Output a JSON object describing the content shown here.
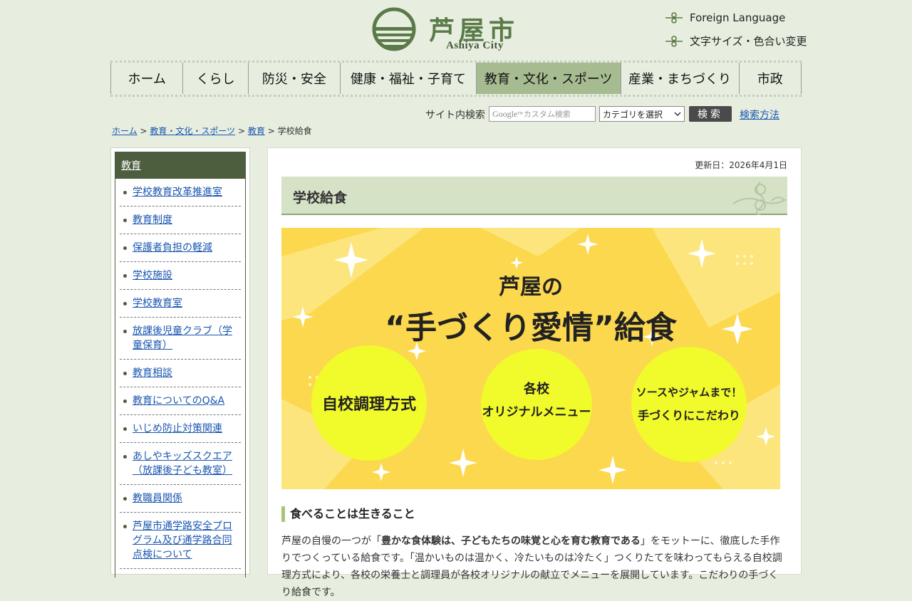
{
  "header": {
    "logo_name": "芦屋市",
    "logo_sub": "Ashiya City",
    "util_links": [
      "Foreign Language",
      "文字サイズ・色合い変更"
    ]
  },
  "nav": {
    "items": [
      "ホーム",
      "くらし",
      "防災・安全",
      "健康・福祉・子育て",
      "教育・文化・スポーツ",
      "産業・まちづくり",
      "市政"
    ],
    "active_index": 4
  },
  "search": {
    "label": "サイト内検索",
    "placeholder_brand": "Google",
    "placeholder_tm": "TM",
    "placeholder_text": "カスタム検索",
    "category_selected": "カテゴリを選択",
    "button": "検索",
    "help_link": "検索方法"
  },
  "breadcrumb": {
    "items": [
      "ホーム",
      "教育・文化・スポーツ",
      "教育"
    ],
    "separator": ">",
    "current": "学校給食"
  },
  "sidebar": {
    "heading": "教育",
    "items": [
      "学校教育改革推進室",
      "教育制度",
      "保護者負担の軽減",
      "学校施設",
      "学校教育室",
      "放課後児童クラブ（学童保育）",
      "教育相談",
      "教育についてのQ&A",
      "いじめ防止対策関連",
      "あしやキッズスクエア（放課後子ども教室）",
      "教職員関係",
      "芦屋市通学路安全プログラム及び通学路合同点検について"
    ]
  },
  "main": {
    "updated": "更新日：2026年4月1日",
    "title": "学校給食",
    "banner": {
      "line1": "芦屋の",
      "line2": "“手づくり愛情”給食",
      "circle1": "自校調理方式",
      "circle2_line1": "各校",
      "circle2_line2": "オリジナルメニュー",
      "circle3_line1": "ソースやジャムまで！",
      "circle3_line2": "手づくりにこだわり"
    },
    "section_heading": "食べることは生きること",
    "paragraph_pre": "芦屋の自慢の一つが「",
    "paragraph_bold": "豊かな食体験は、子どもたちの味覚と心を育む教育である",
    "paragraph_post": "」をモットーに、徹底した手作りでつくっている給食です。「温かいものは温かく、冷たいものは冷たく」つくりたてを味わってもらえる自校調理方式により、各校の栄養士と調理員が各校オリジナルの献立でメニューを展開しています。こだわりの手づくり給食です。"
  },
  "colors": {
    "page_bg": "#e7eedf",
    "nav_active": "#a7bb91",
    "sidebar_head": "#4d5e3e",
    "title_bar": "#d5e2c6",
    "banner_bg": "#fbd84e",
    "banner_circle": "#f1fa2a",
    "logo_green": "#5a7a48"
  },
  "icons": {
    "logo_mark": "city-emblem-icon",
    "util_link": "clover-bullet-icon",
    "title_deco": "ornament-scroll-icon"
  }
}
